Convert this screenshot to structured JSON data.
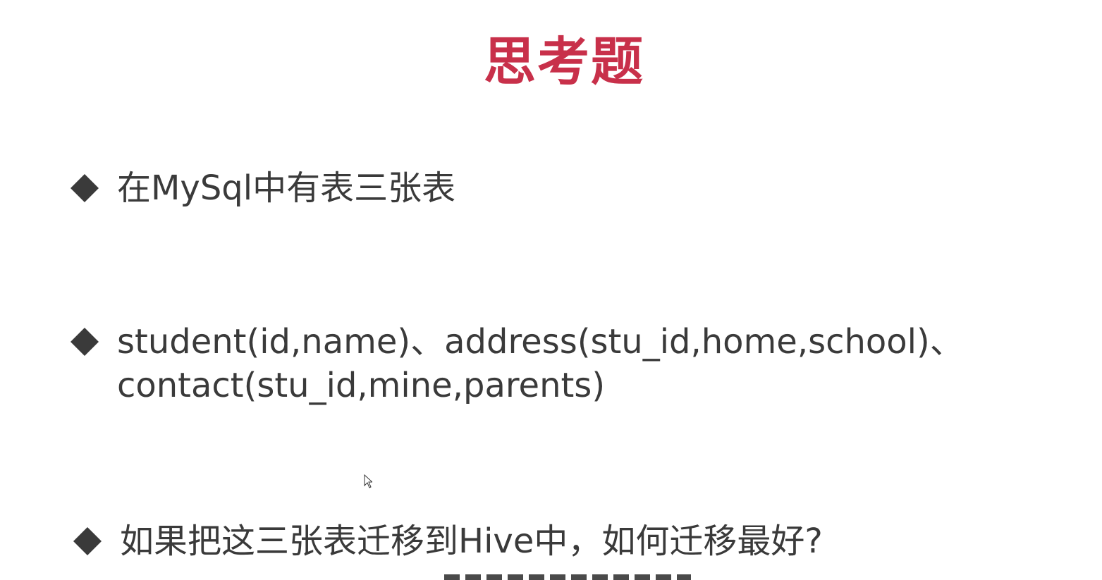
{
  "slide": {
    "title": "思考题",
    "title_color": "#c8304a",
    "bullet_icon": "diamond-bullet-icon",
    "bullets": [
      {
        "text": "在MySql中有表三张表"
      },
      {
        "text": "student(id,name)、address(stu_id,home,school)、\ncontact(stu_id,mine,parents)"
      },
      {
        "text": "如果把这三张表迁移到Hive中，如何迁移最好?"
      }
    ]
  }
}
